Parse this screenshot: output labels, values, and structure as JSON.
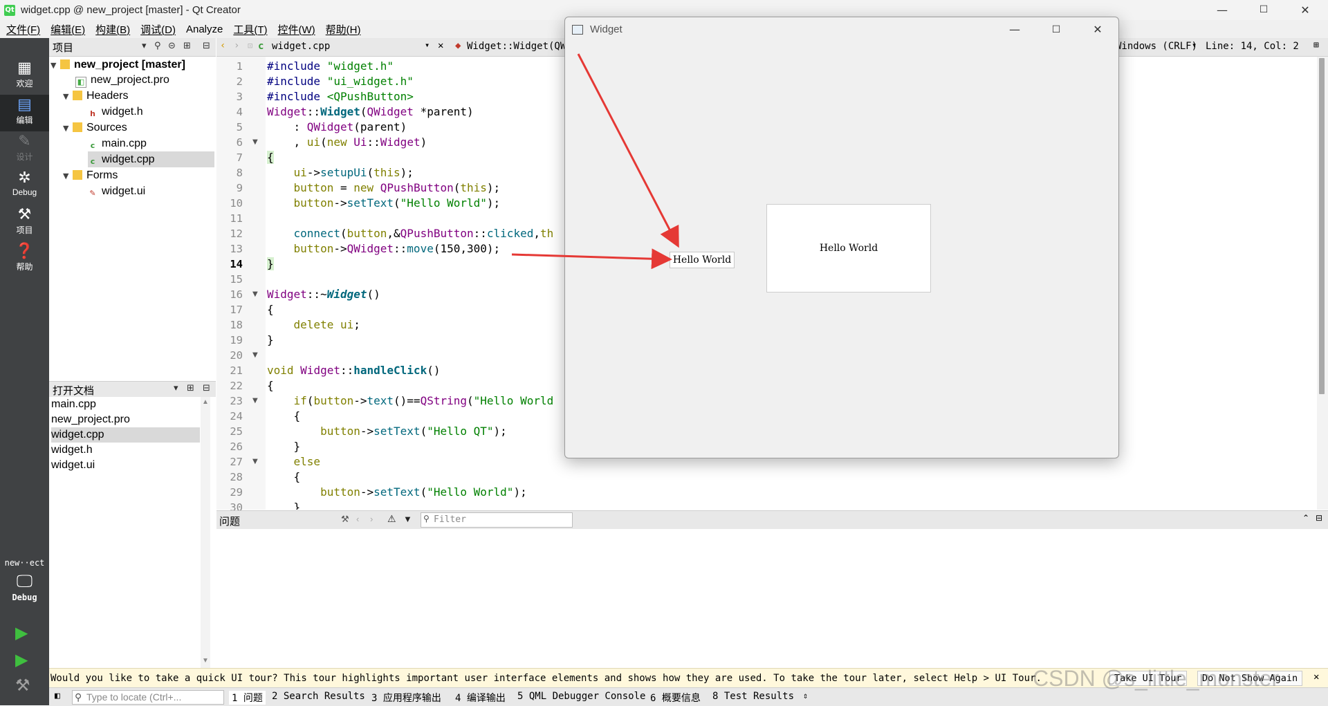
{
  "window": {
    "title": "widget.cpp @ new_project [master] - Qt Creator",
    "app_icon": "Qt",
    "minimize": "—",
    "maximize": "☐",
    "close": "✕"
  },
  "menu": [
    "文件(F)",
    "编辑(E)",
    "构建(B)",
    "调试(D)",
    "Analyze",
    "工具(T)",
    "控件(W)",
    "帮助(H)"
  ],
  "modes": [
    {
      "label": "欢迎",
      "icon": "grid-icon"
    },
    {
      "label": "编辑",
      "icon": "document-icon"
    },
    {
      "label": "设计",
      "icon": "pencil-icon"
    },
    {
      "label": "Debug",
      "icon": "bug-icon"
    },
    {
      "label": "项目",
      "icon": "wrench-icon"
    },
    {
      "label": "帮助",
      "icon": "help-icon"
    }
  ],
  "kit": {
    "project": "new··ect",
    "mode": "Debug"
  },
  "project_panel": {
    "header": "项目",
    "tree": [
      {
        "label": "new_project [master]",
        "depth": 0,
        "icon": "project-folder-icon",
        "expanded": true,
        "bold": true
      },
      {
        "label": "new_project.pro",
        "depth": 1,
        "icon": "pro-file-icon"
      },
      {
        "label": "Headers",
        "depth": 1,
        "icon": "folder-icon",
        "expanded": true
      },
      {
        "label": "widget.h",
        "depth": 2,
        "icon": "header-file-icon"
      },
      {
        "label": "Sources",
        "depth": 1,
        "icon": "folder-icon",
        "expanded": true
      },
      {
        "label": "main.cpp",
        "depth": 2,
        "icon": "cpp-file-icon"
      },
      {
        "label": "widget.cpp",
        "depth": 2,
        "icon": "cpp-file-icon",
        "selected": true
      },
      {
        "label": "Forms",
        "depth": 1,
        "icon": "folder-icon",
        "expanded": true
      },
      {
        "label": "widget.ui",
        "depth": 2,
        "icon": "ui-file-icon"
      }
    ]
  },
  "open_docs": {
    "header": "打开文档",
    "items": [
      "main.cpp",
      "new_project.pro",
      "widget.cpp",
      "widget.h",
      "widget.ui"
    ],
    "selected": "widget.cpp"
  },
  "editor": {
    "file_tab": "widget.cpp",
    "symbol": "Widget::Widget(QWi",
    "line_ending": "Windows (CRLF)",
    "position": "Line: 14, Col: 2",
    "current_line": 14,
    "lines": [
      "1",
      "2",
      "3",
      "4",
      "5",
      "6",
      "7",
      "8",
      "9",
      "10",
      "11",
      "12",
      "13",
      "14",
      "15",
      "16",
      "17",
      "18",
      "19",
      "20",
      "21",
      "22",
      "23",
      "24",
      "25",
      "26",
      "27",
      "28",
      "29",
      "30"
    ]
  },
  "issues": {
    "header": "问题",
    "filter_placeholder": "Filter"
  },
  "tour": {
    "message": "Would you like to take a quick UI tour? This tour highlights important user interface elements and shows how they are used. To take the tour later, select Help > UI Tour.",
    "take_label": "Take UI Tour",
    "dismiss_label": "Do Not Show Again"
  },
  "statusbar": {
    "locate_placeholder": "Type to locate (Ctrl+...",
    "tabs": [
      "1 问题",
      "2 Search Results",
      "3 应用程序输出",
      "4 编译输出",
      "5 QML Debugger Console",
      "6 概要信息",
      "8 Test Results"
    ]
  },
  "widget_window": {
    "title": "Widget",
    "small_button": "Hello World",
    "big_button": "Hello World"
  },
  "watermark": "CSDN @s_little_monster",
  "colors": {
    "keyword": "#808000",
    "type": "#800080",
    "function": "#00677c",
    "string": "#008000",
    "arrow": "#e53935"
  }
}
